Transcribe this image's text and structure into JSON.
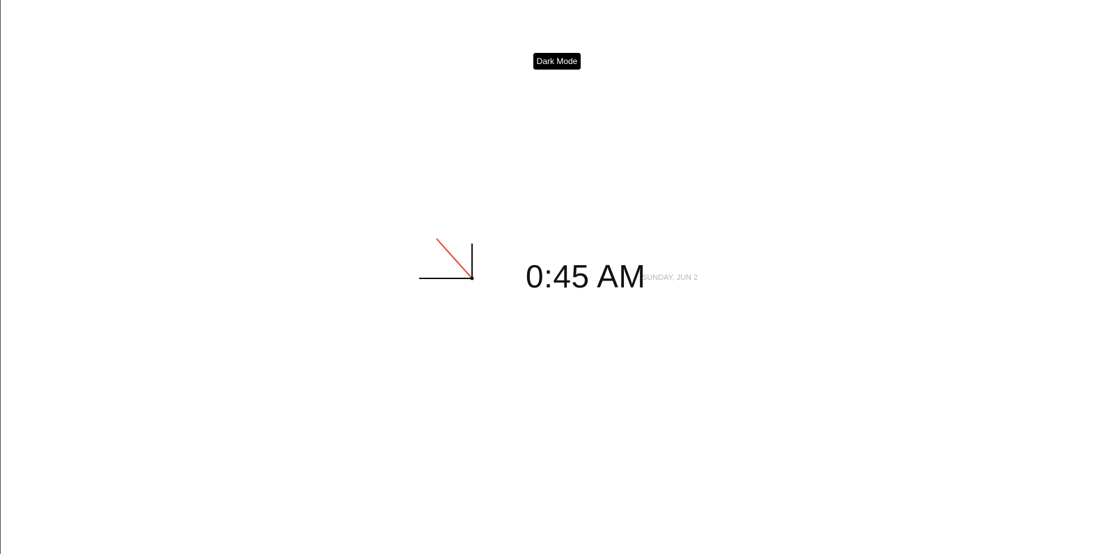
{
  "toolbar": {
    "dark_mode_label": "Dark Mode"
  },
  "clock": {
    "hour_hand_color": "#111111",
    "minute_hand_color": "#111111",
    "second_hand_color": "#e14a3b",
    "center_dot_color": "#111111"
  },
  "time": {
    "display": "0:45 AM",
    "date": "SUNDAY, JUN 2"
  },
  "theme": {
    "background": "#ffffff",
    "button_background": "#000000",
    "button_text": "#ffffff",
    "time_text": "#111111",
    "date_text": "#b5b5b5"
  }
}
